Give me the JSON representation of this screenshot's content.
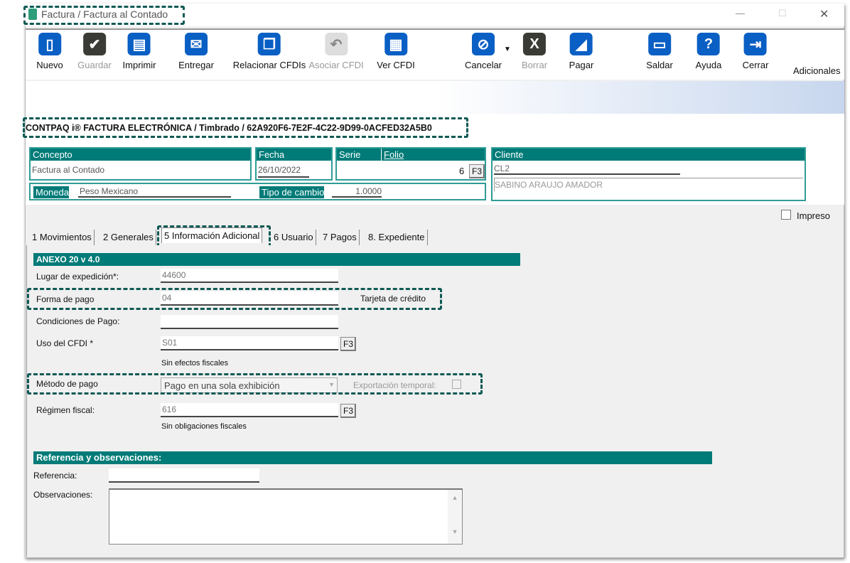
{
  "window": {
    "title": "Factura / Factura al Contado",
    "minimize": "—",
    "maximize": "☐",
    "close": "✕"
  },
  "toolbar": [
    {
      "label": "Nuevo",
      "icon": "new-document-icon",
      "glyph": "▯",
      "enabled": true
    },
    {
      "label": "Guardar",
      "icon": "save-check-icon",
      "glyph": "✔",
      "enabled": false
    },
    {
      "label": "Imprimir",
      "icon": "printer-icon",
      "glyph": "▤",
      "enabled": true
    },
    {
      "label": "Entregar",
      "icon": "deliver-icon",
      "glyph": "✉",
      "enabled": true
    },
    {
      "label": "Relacionar CFDIs",
      "icon": "related-docs-icon",
      "glyph": "❐",
      "enabled": true
    },
    {
      "label": "Asociar CFDI",
      "icon": "associate-icon",
      "glyph": "↶",
      "enabled": false
    },
    {
      "label": "Ver CFDI",
      "icon": "view-cfdi-icon",
      "glyph": "▦",
      "enabled": true
    },
    {
      "label": "Cancelar",
      "icon": "cancel-icon",
      "glyph": "⊘",
      "enabled": true
    },
    {
      "label": "Borrar",
      "icon": "delete-icon",
      "glyph": "X",
      "enabled": false
    },
    {
      "label": "Pagar",
      "icon": "pay-icon",
      "glyph": "◢",
      "enabled": true
    },
    {
      "label": "Saldar",
      "icon": "settle-icon",
      "glyph": "▭",
      "enabled": true
    },
    {
      "label": "Ayuda",
      "icon": "help-icon",
      "glyph": "?",
      "enabled": true
    },
    {
      "label": "Cerrar",
      "icon": "exit-door-icon",
      "glyph": "⇥",
      "enabled": true
    }
  ],
  "adicionales": "Adicionales",
  "doc_header": "CONTPAQ i® FACTURA ELECTRÓNICA / Timbrado / 62A920F6-7E2F-4C22-9D99-0ACFED32A5B0",
  "header": {
    "concepto_label": "Concepto",
    "concepto": "Factura al Contado",
    "fecha_label": "Fecha",
    "fecha": "26/10/2022",
    "serie_label": "Serie",
    "folio_label": "Folio",
    "folio": "6",
    "f3": "F3",
    "cliente_label": "Cliente",
    "cliente_code": "CL2",
    "cliente_name": "SABINO ARAUJO AMADOR",
    "moneda_label": "Moneda",
    "moneda": "Peso Mexicano",
    "tipo_cambio_label": "Tipo de cambio",
    "tipo_cambio": "1.0000"
  },
  "impreso_label": "Impreso",
  "tabs": [
    "1 Movimientos",
    "2 Generales",
    "5 Información Adicional",
    "6 Usuario",
    "7 Pagos",
    "8. Expediente"
  ],
  "anexo": {
    "title": "ANEXO 20 v 4.0",
    "lugar_label": "Lugar de expedición*:",
    "lugar": "44600",
    "forma_label": "Forma de pago",
    "forma": "04",
    "forma_desc": "Tarjeta de crédito",
    "condiciones_label": "Condiciones de Pago:",
    "condiciones": "",
    "uso_label": "Uso del CFDI *",
    "uso": "S01",
    "uso_desc": "Sin efectos fiscales",
    "metodo_label": "Método de pago",
    "metodo": "Pago en una sola exhibición",
    "exportacion_label": "Exportación temporal:",
    "regimen_label": "Régimen fiscal:",
    "regimen": "616",
    "regimen_desc": "Sin obligaciones fiscales",
    "f3": "F3"
  },
  "referencia": {
    "title": "Referencia y observaciones:",
    "referencia_label": "Referencia:",
    "observaciones_label": "Observaciones:"
  }
}
